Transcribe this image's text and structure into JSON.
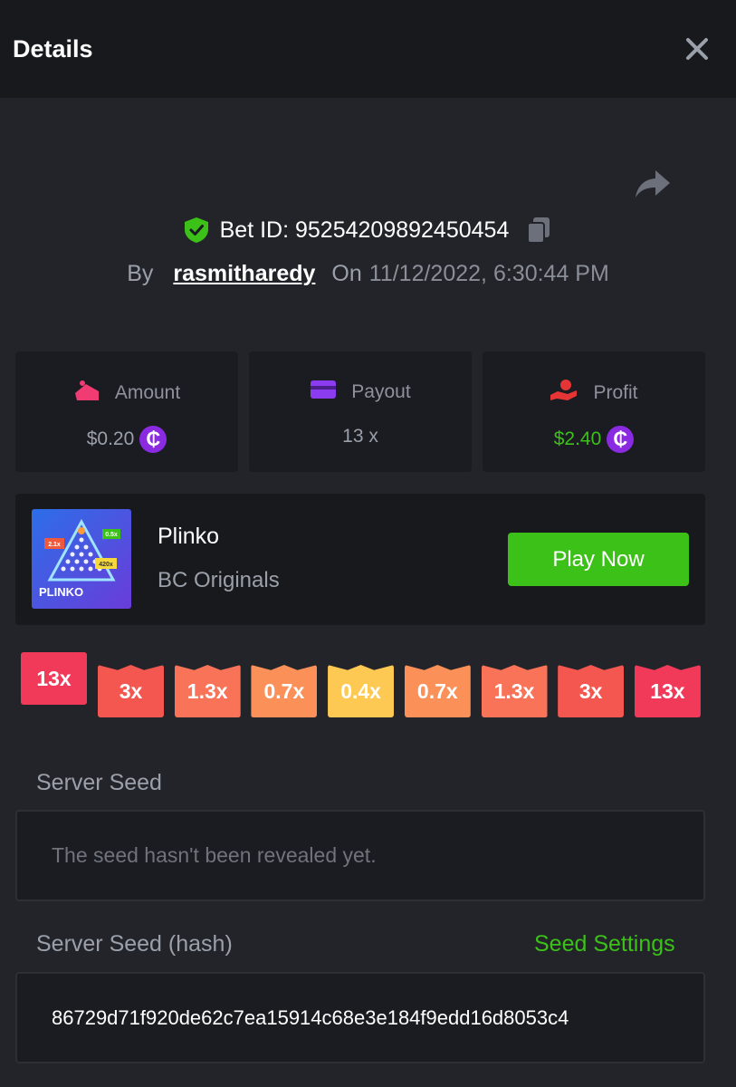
{
  "header": {
    "title": "Details",
    "close_icon": "close-icon"
  },
  "bet": {
    "id_text": "Bet ID: 95254209892450454",
    "by_label": "By",
    "username": "rasmitharedy",
    "on_label": "On",
    "date": "11/12/2022, 6:30:44 PM"
  },
  "stats": {
    "amount": {
      "label": "Amount",
      "value": "$0.20"
    },
    "payout": {
      "label": "Payout",
      "value": "13 x"
    },
    "profit": {
      "label": "Profit",
      "value": "$2.40"
    }
  },
  "coin_symbol": "₵",
  "game": {
    "name": "Plinko",
    "provider": "BC Originals",
    "play_label": "Play Now",
    "thumb_text": "PLINKO",
    "thumb_tags": [
      "2.1x",
      "0.5x",
      "420x"
    ]
  },
  "multipliers": [
    {
      "label": "13x",
      "color": "#f13a5a",
      "active": true
    },
    {
      "label": "3x",
      "color": "#f4574f",
      "active": false
    },
    {
      "label": "1.3x",
      "color": "#f87358",
      "active": false
    },
    {
      "label": "0.7x",
      "color": "#fb9158",
      "active": false
    },
    {
      "label": "0.4x",
      "color": "#fec953",
      "active": false
    },
    {
      "label": "0.7x",
      "color": "#fb9158",
      "active": false
    },
    {
      "label": "1.3x",
      "color": "#f87358",
      "active": false
    },
    {
      "label": "3x",
      "color": "#f4574f",
      "active": false
    },
    {
      "label": "13x",
      "color": "#f13a5a",
      "active": false
    }
  ],
  "seeds": {
    "server_seed_label": "Server Seed",
    "server_seed_value": "The seed hasn't been revealed yet.",
    "hash_label": "Server Seed (hash)",
    "seed_settings_label": "Seed Settings",
    "hash_value": "86729d71f920de62c7ea15914c68e3e184f9edd16d8053c4"
  },
  "colors": {
    "accent_green": "#3bc117",
    "coin_purple": "#8a2be2",
    "background": "#232429",
    "panel": "#1b1c21"
  }
}
